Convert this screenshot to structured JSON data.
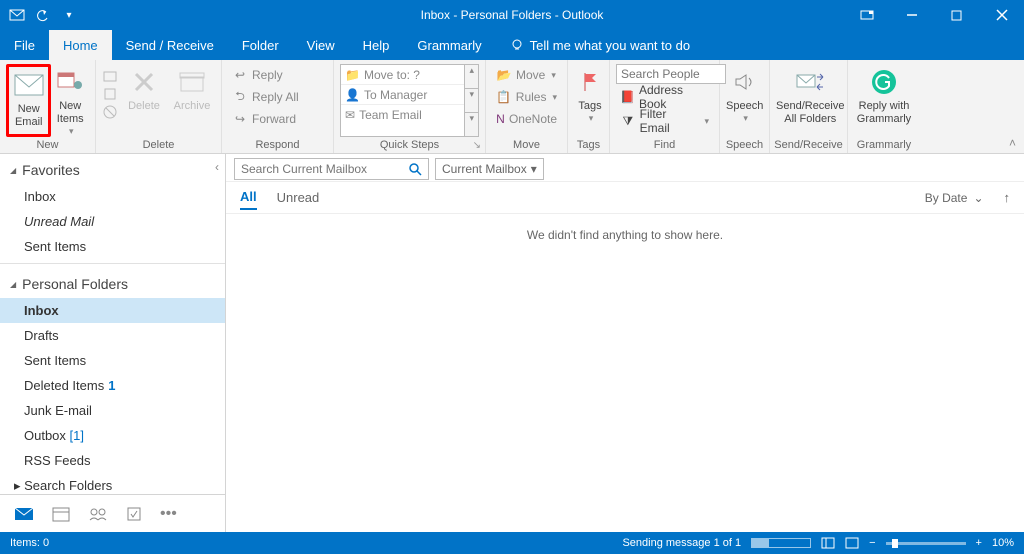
{
  "title": "Inbox - Personal Folders  -  Outlook",
  "menu": {
    "file": "File",
    "home": "Home",
    "sendreceive": "Send / Receive",
    "folder": "Folder",
    "view": "View",
    "help": "Help",
    "grammarly": "Grammarly",
    "tell": "Tell me what you want to do"
  },
  "ribbon": {
    "new": {
      "new_email_l1": "New",
      "new_email_l2": "Email",
      "new_items_l1": "New",
      "new_items_l2": "Items",
      "label": "New"
    },
    "delete": {
      "delete": "Delete",
      "archive": "Archive",
      "label": "Delete"
    },
    "respond": {
      "reply": "Reply",
      "reply_all": "Reply All",
      "forward": "Forward",
      "label": "Respond"
    },
    "quick": {
      "move_to": "Move to: ?",
      "to_manager": "To Manager",
      "team_email": "Team Email",
      "label": "Quick Steps"
    },
    "move": {
      "move": "Move",
      "rules": "Rules",
      "onenote": "OneNote",
      "label": "Move"
    },
    "tags": {
      "label_btn": "Tags",
      "label": "Tags"
    },
    "find": {
      "search_ph": "Search People",
      "address": "Address Book",
      "filter": "Filter Email",
      "label": "Find"
    },
    "speech": {
      "speech": "Speech",
      "label": "Speech"
    },
    "sr": {
      "l1": "Send/Receive",
      "l2": "All Folders",
      "label": "Send/Receive"
    },
    "gr": {
      "l1": "Reply with",
      "l2": "Grammarly",
      "label": "Grammarly"
    }
  },
  "nav": {
    "favorites": "Favorites",
    "fav_inbox": "Inbox",
    "fav_unread": "Unread Mail",
    "fav_sent": "Sent Items",
    "pf": "Personal Folders",
    "inbox": "Inbox",
    "drafts": "Drafts",
    "sent": "Sent Items",
    "deleted": "Deleted Items",
    "deleted_count": "1",
    "junk": "Junk E-mail",
    "outbox": "Outbox",
    "outbox_count": "[1]",
    "rss": "RSS Feeds",
    "search_folders": "Search Folders"
  },
  "search": {
    "placeholder": "Search Current Mailbox",
    "scope": "Current Mailbox"
  },
  "filter": {
    "all": "All",
    "unread": "Unread",
    "by_date": "By Date"
  },
  "empty": "We didn't find anything to show here.",
  "status": {
    "items": "Items: 0",
    "sending": "Sending message 1 of 1",
    "zoom": "10%"
  }
}
